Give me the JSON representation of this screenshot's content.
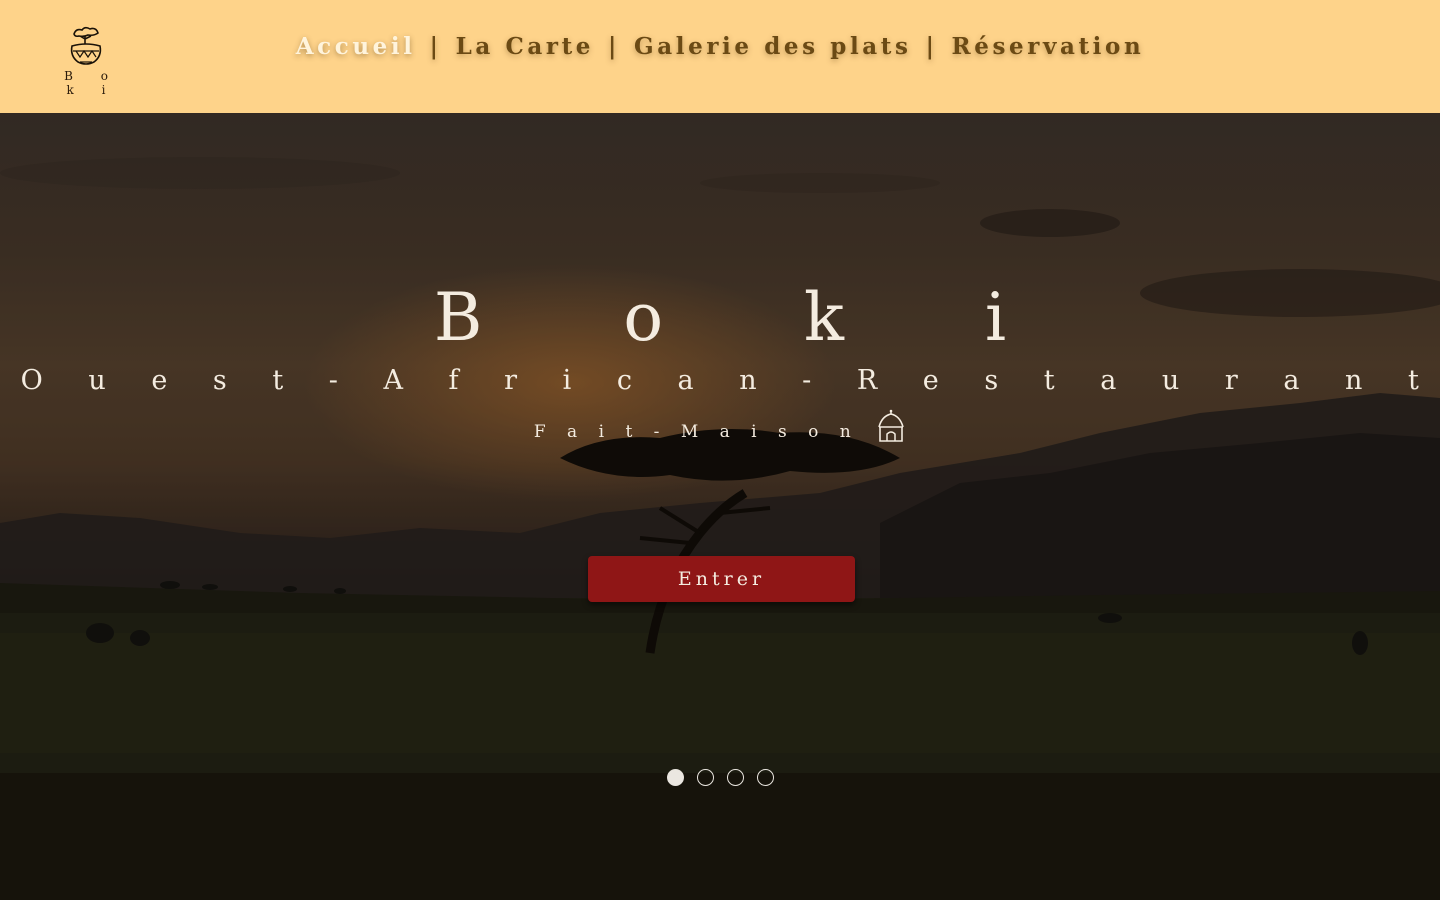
{
  "header": {
    "logo_text": "B o k i",
    "background_color": "#fed38a",
    "nav": [
      {
        "label": "Accueil",
        "active": true
      },
      {
        "label": "La Carte",
        "active": false
      },
      {
        "label": "Galerie des plats",
        "active": false
      },
      {
        "label": "Réservation",
        "active": false
      }
    ],
    "separator": "|"
  },
  "hero": {
    "title": "B o k i",
    "subtitle": "O u e s t - A f r i c a n - R e s t a u r a n t",
    "tagline": "F a i t - M a i s o n",
    "tagline_icon": "hut-icon",
    "enter_label": "Entrer",
    "enter_color": "#8f1616",
    "slides_total": 4,
    "slide_active": 1
  }
}
